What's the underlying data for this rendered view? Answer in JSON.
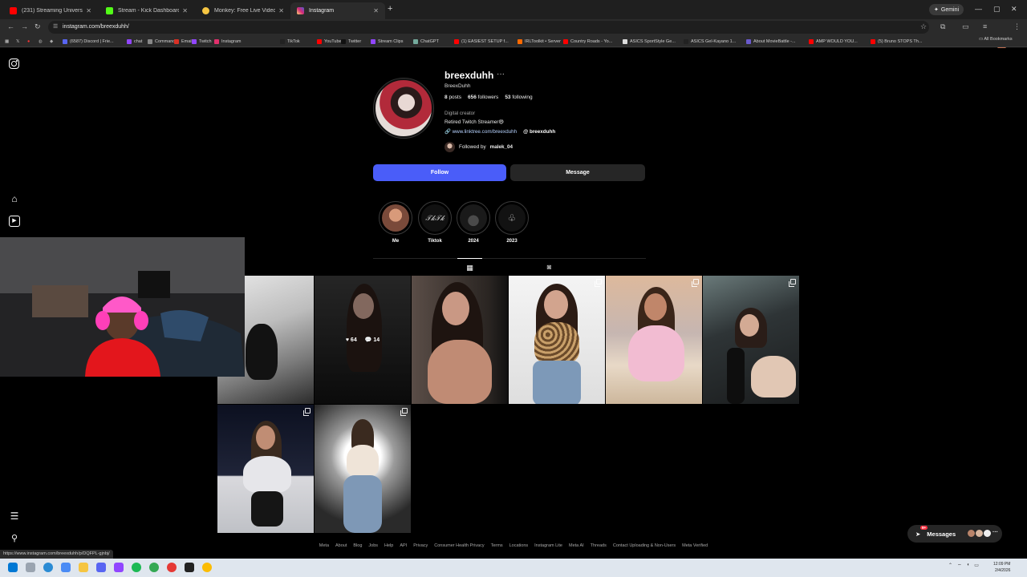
{
  "browser": {
    "tabs": [
      {
        "label": "(231) Streaming University",
        "color": "#ff0000"
      },
      {
        "label": "Stream - Kick Dashboard",
        "color": "#53fc18"
      },
      {
        "label": "Monkey: Free Live Video Chat",
        "color": "#f5c542"
      },
      {
        "label": "Instagram",
        "color": "#e1306c"
      }
    ],
    "gemini_label": "Gemini",
    "url": "instagram.com/breexduhh/",
    "bookmarks": [
      {
        "label": "(6587) Discord | Frie...",
        "color": "#5865f2"
      },
      {
        "label": "chat",
        "color": "#9146ff"
      },
      {
        "label": "Commands",
        "color": "#888888"
      },
      {
        "label": "Email",
        "color": "#d93025"
      },
      {
        "label": "Twitch",
        "color": "#9146ff"
      },
      {
        "label": "Instagram",
        "color": "#e1306c"
      },
      {
        "label": "TikTok",
        "color": "#222222"
      },
      {
        "label": "YouTube",
        "color": "#ff0000"
      },
      {
        "label": "Twitter",
        "color": "#111111"
      },
      {
        "label": "Stream Clips",
        "color": "#9146ff"
      },
      {
        "label": "ChatGPT",
        "color": "#74aa9c"
      },
      {
        "label": "(1) EASIEST SETUP f...",
        "color": "#ff0000"
      },
      {
        "label": "IRLToolkit • Server",
        "color": "#ff6a00"
      },
      {
        "label": "Country Roads - Yo...",
        "color": "#ff0000"
      },
      {
        "label": "ASICS SportStyle Ge...",
        "color": "#dddddd"
      },
      {
        "label": "ASICS Gel-Kayano 1...",
        "color": "#222222"
      },
      {
        "label": "About MovieBattle -...",
        "color": "#6a5acd"
      },
      {
        "label": "AMP WOULD YOU...",
        "color": "#ff0000"
      },
      {
        "label": "(5) Bruno STOPS Th...",
        "color": "#ff0000"
      }
    ],
    "all_bookmarks": "All Bookmarks",
    "status_url": "https://www.instagram.com/breexduhh/p/DQFPL-gjnbj/"
  },
  "profile": {
    "username": "breexduhh",
    "more": "···",
    "display_name": "BreexDuhh",
    "posts_count": "8",
    "posts_label": "posts",
    "followers_count": "656",
    "followers_label": "followers",
    "following_count": "53",
    "following_label": "following",
    "category": "Digital creator",
    "bio": "Retired Twitch Streamer😄",
    "link": "www.linktree.com/breexduhh",
    "threads_handle": "breexduhh",
    "followed_by_prefix": "Followed by",
    "followed_by_user": "malek_04",
    "follow_label": "Follow",
    "message_label": "Message"
  },
  "highlights": [
    {
      "label": "Me"
    },
    {
      "label": "Tiktok"
    },
    {
      "label": "2024"
    },
    {
      "label": "2023"
    }
  ],
  "tabs": {
    "grid_icon": "grid-icon",
    "tagged_icon": "tagged-icon"
  },
  "posts": [
    {
      "likes": "",
      "comments": ""
    },
    {
      "likes": "64",
      "comments": "14"
    },
    {
      "likes": "",
      "comments": ""
    },
    {
      "likes": "",
      "comments": ""
    },
    {
      "likes": "",
      "comments": ""
    },
    {
      "likes": "",
      "comments": ""
    },
    {
      "likes": "",
      "comments": ""
    },
    {
      "likes": "",
      "comments": ""
    }
  ],
  "footer": [
    "Meta",
    "About",
    "Blog",
    "Jobs",
    "Help",
    "API",
    "Privacy",
    "Consumer Health Privacy",
    "Terms",
    "Locations",
    "Instagram Lite",
    "Meta AI",
    "Threads",
    "Contact Uploading & Non-Users",
    "Meta Verified"
  ],
  "messages": {
    "label": "Messages",
    "badge": "9+"
  },
  "taskbar": {
    "time": "12:09 PM",
    "date": "2/4/2026"
  },
  "colors": {
    "follow_blue": "#4a5df9",
    "background": "#000000"
  }
}
